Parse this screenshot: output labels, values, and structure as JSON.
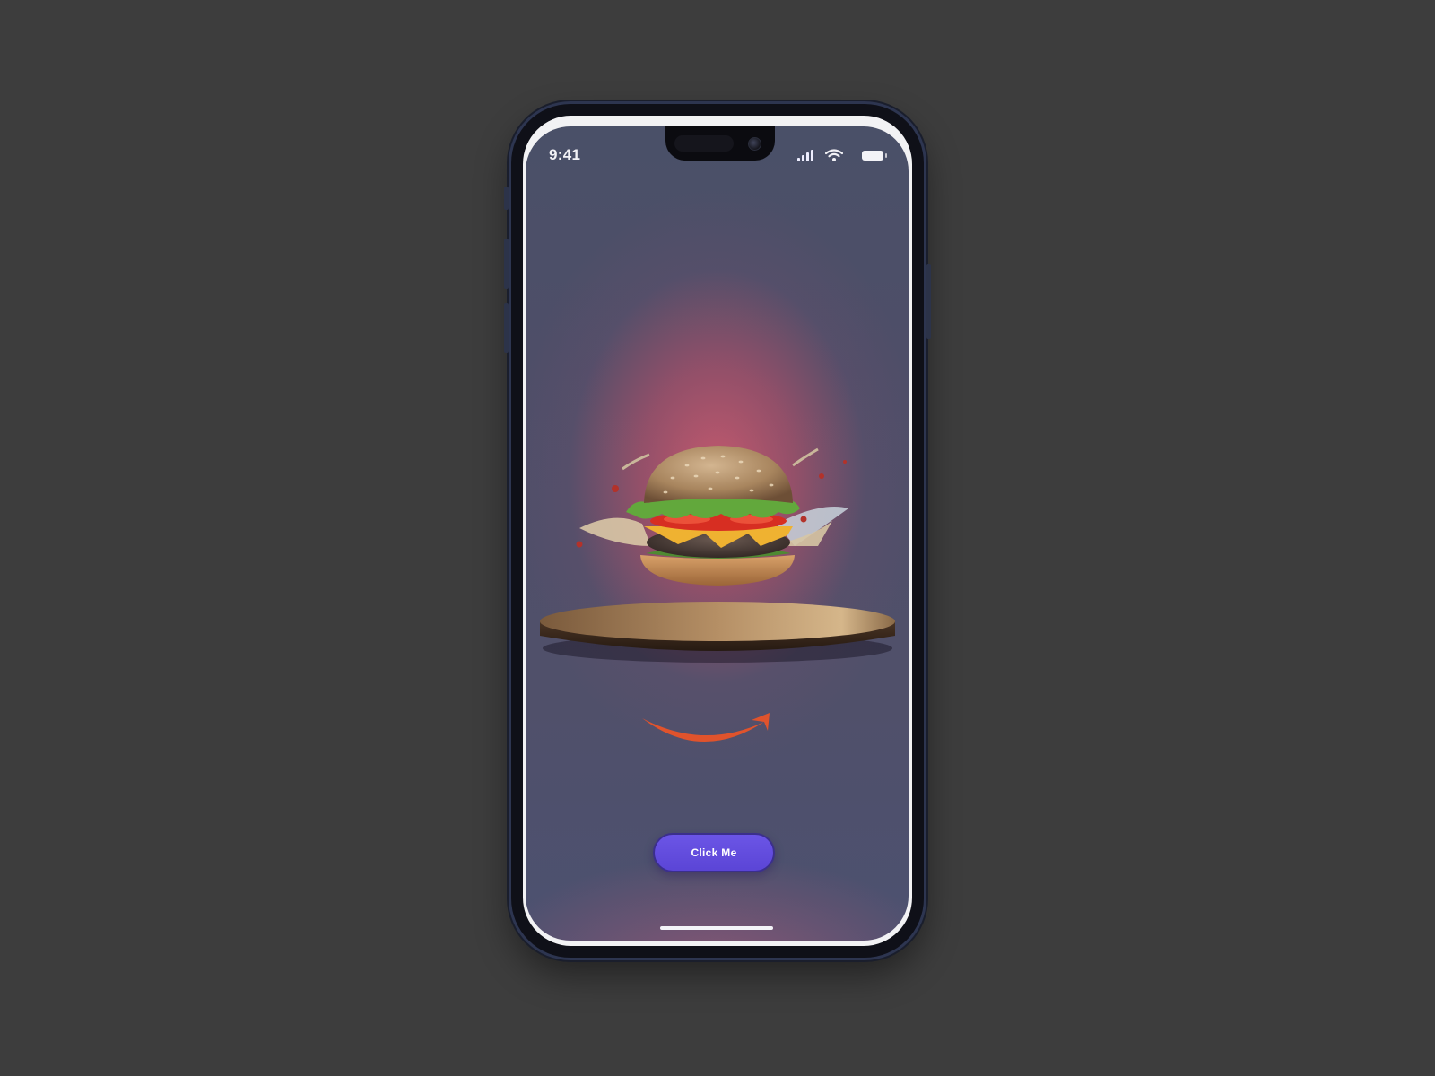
{
  "status_bar": {
    "time": "9:41",
    "icons": [
      "cellular-signal-icon",
      "wifi-icon",
      "battery-icon"
    ]
  },
  "hero": {
    "illustration": "burger-on-wooden-board",
    "logo": "smile-arrow-logo"
  },
  "cta": {
    "label": "Click Me"
  },
  "colors": {
    "page_background": "#3d3d3d",
    "screen_background": "#4d4f6a",
    "glow": "#cd5a6e",
    "button": "#5f49dc",
    "logo": "#e0532c"
  }
}
